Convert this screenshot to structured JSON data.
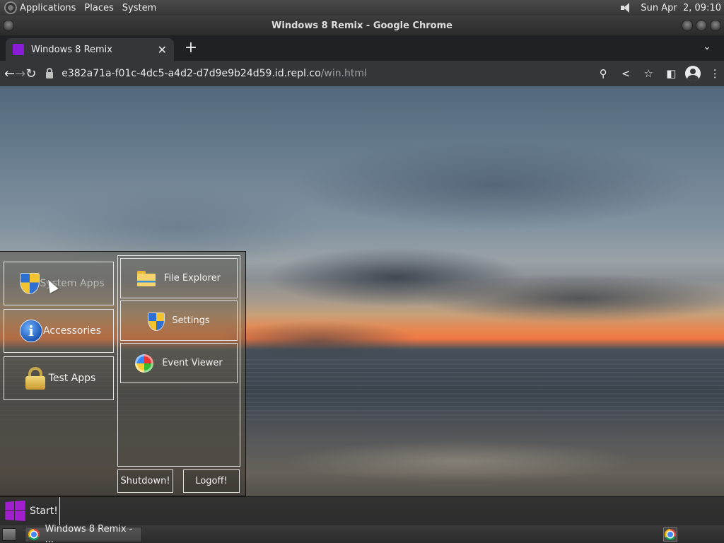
{
  "top_panel": {
    "menus": [
      "Applications",
      "Places",
      "System"
    ],
    "datetime": "Sun Apr  2, 09:10"
  },
  "window": {
    "title": "Windows 8 Remix - Google Chrome"
  },
  "browser": {
    "tab": {
      "title": "Windows 8 Remix",
      "favicon_color": "#8a1bd6"
    },
    "url_host": "e382a71a-f01c-4dc5-a4d2-d7d9e9b24d59.id.repl.co",
    "url_path": "/win.html"
  },
  "start_menu": {
    "left_tiles": [
      {
        "label": "System Apps",
        "icon": "shield-icon"
      },
      {
        "label": "Accessories",
        "icon": "info-icon"
      },
      {
        "label": "Test Apps",
        "icon": "padlock-icon"
      }
    ],
    "right_tiles": [
      {
        "label": "File Explorer",
        "icon": "folder-icon"
      },
      {
        "label": "Settings",
        "icon": "shield-icon"
      },
      {
        "label": "Event Viewer",
        "icon": "orb-icon"
      }
    ],
    "shutdown_label": "Shutdown!",
    "logoff_label": "Logoff!"
  },
  "taskbar": {
    "start_label": "Start!",
    "logo_color": "#a21fd0"
  },
  "bottom_panel": {
    "task_label": "Windows 8 Remix - ..."
  }
}
